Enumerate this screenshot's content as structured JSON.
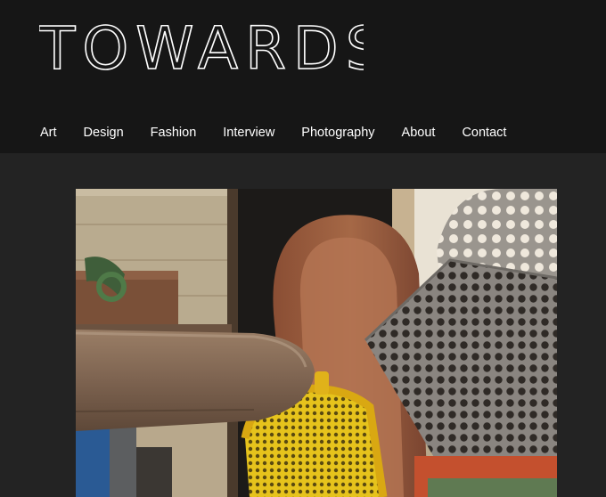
{
  "site": {
    "logo_text": "TOWARDS"
  },
  "nav": {
    "items": [
      {
        "label": "Art"
      },
      {
        "label": "Design"
      },
      {
        "label": "Fashion"
      },
      {
        "label": "Interview"
      },
      {
        "label": "Photography"
      },
      {
        "label": "About"
      },
      {
        "label": "Contact"
      }
    ]
  },
  "colors": {
    "header_bg": "#161616",
    "page_bg": "#232323",
    "nav_text": "#ffffff"
  }
}
